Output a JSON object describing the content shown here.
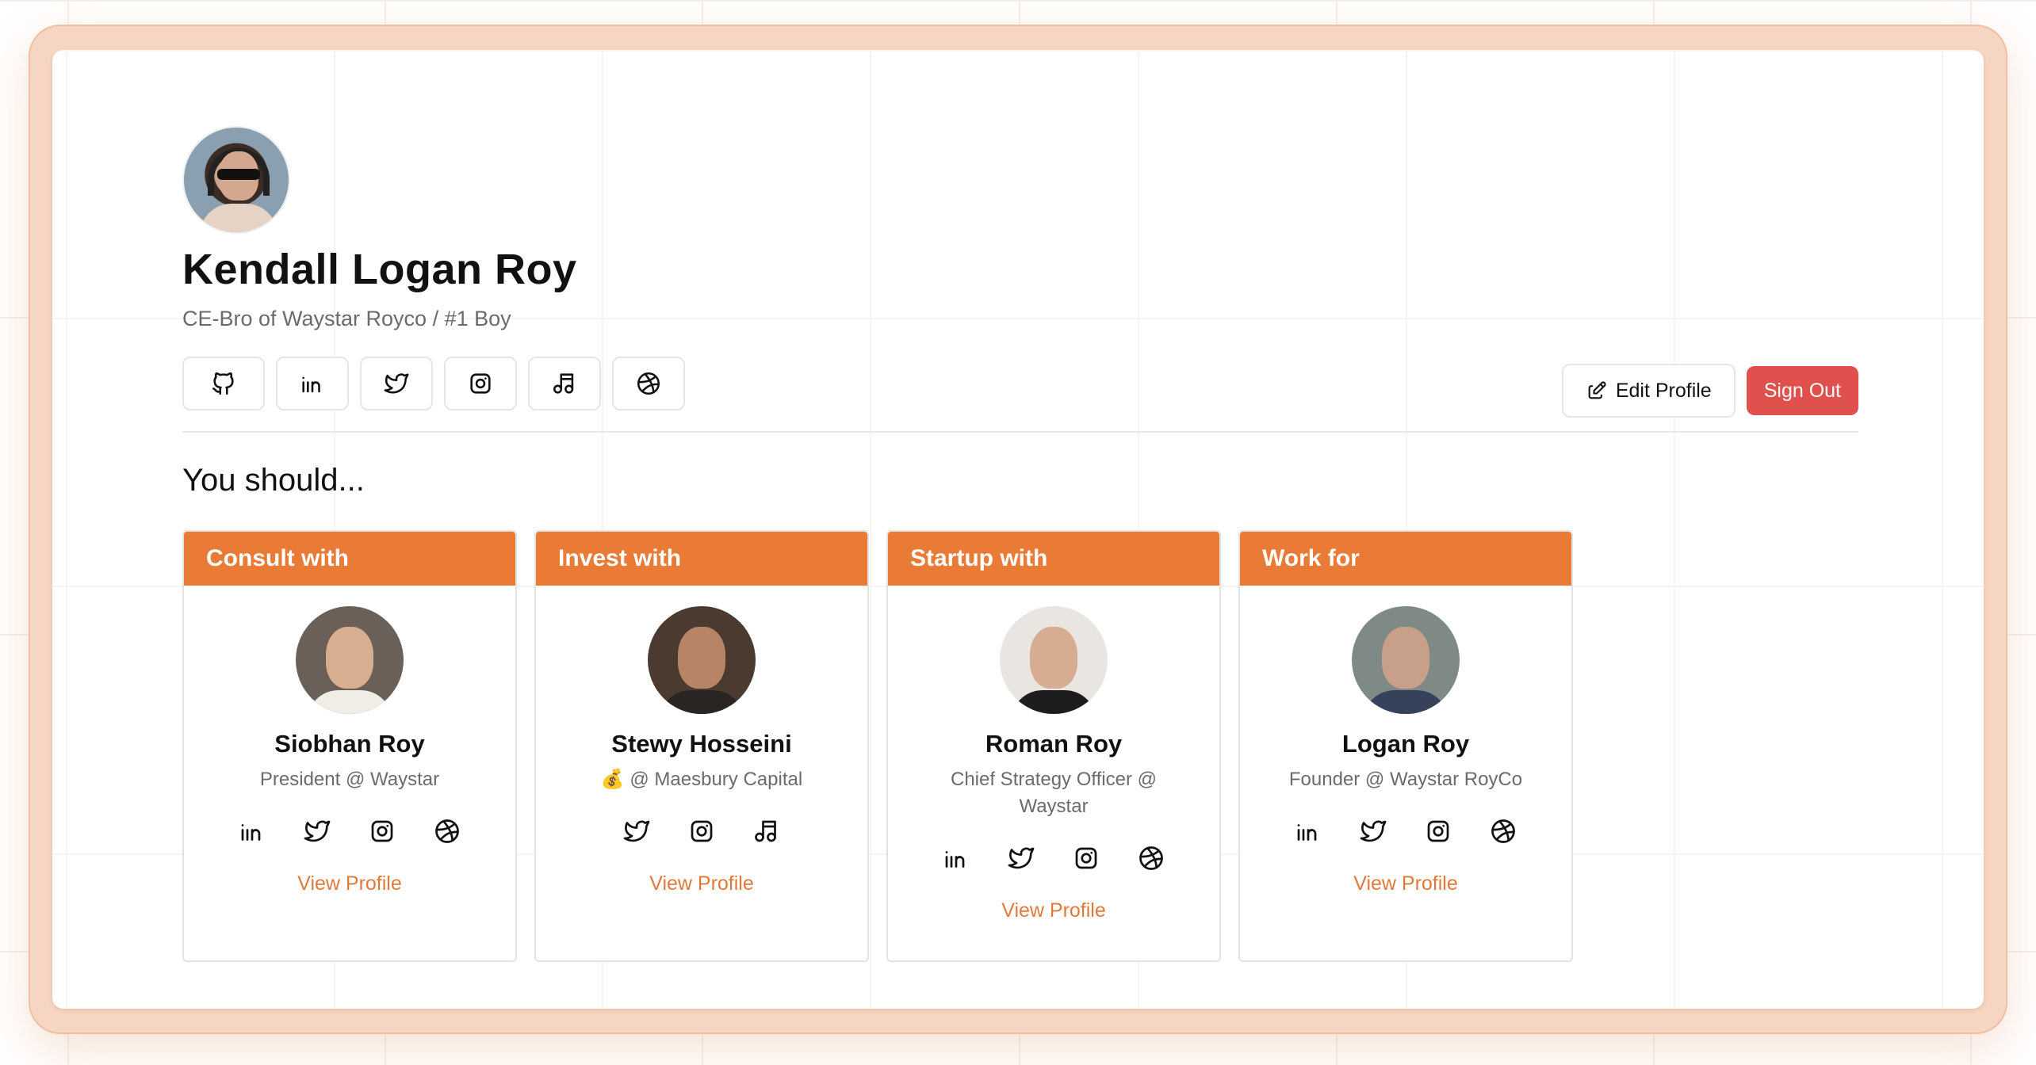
{
  "profile": {
    "name": "Kendall Logan Roy",
    "subtitle": "CE-Bro of Waystar Royco / #1 Boy",
    "social_icons": [
      "github-icon",
      "linkedin-icon",
      "twitter-icon",
      "instagram-icon",
      "music-icon",
      "dribbble-icon"
    ]
  },
  "actions": {
    "edit_label": "Edit Profile",
    "signout_label": "Sign Out"
  },
  "section": {
    "title": "You should..."
  },
  "cards": [
    {
      "header": "Consult with",
      "name": "Siobhan Roy",
      "role": "President @ Waystar",
      "icons": [
        "linkedin-icon",
        "twitter-icon",
        "instagram-icon",
        "dribbble-icon"
      ],
      "link": "View Profile"
    },
    {
      "header": "Invest with",
      "name": "Stewy Hosseini",
      "role": "💰 @ Maesbury Capital",
      "icons": [
        "twitter-icon",
        "instagram-icon",
        "music-icon"
      ],
      "link": "View Profile"
    },
    {
      "header": "Startup with",
      "name": "Roman Roy",
      "role": "Chief Strategy Officer @ Waystar",
      "icons": [
        "linkedin-icon",
        "twitter-icon",
        "instagram-icon",
        "dribbble-icon"
      ],
      "link": "View Profile"
    },
    {
      "header": "Work for",
      "name": "Logan Roy",
      "role": "Founder @ Waystar RoyCo",
      "icons": [
        "linkedin-icon",
        "twitter-icon",
        "instagram-icon",
        "dribbble-icon"
      ],
      "link": "View Profile"
    }
  ],
  "colors": {
    "accent": "#e97b36",
    "danger": "#e0514e",
    "frame": "#f6d6c3"
  }
}
